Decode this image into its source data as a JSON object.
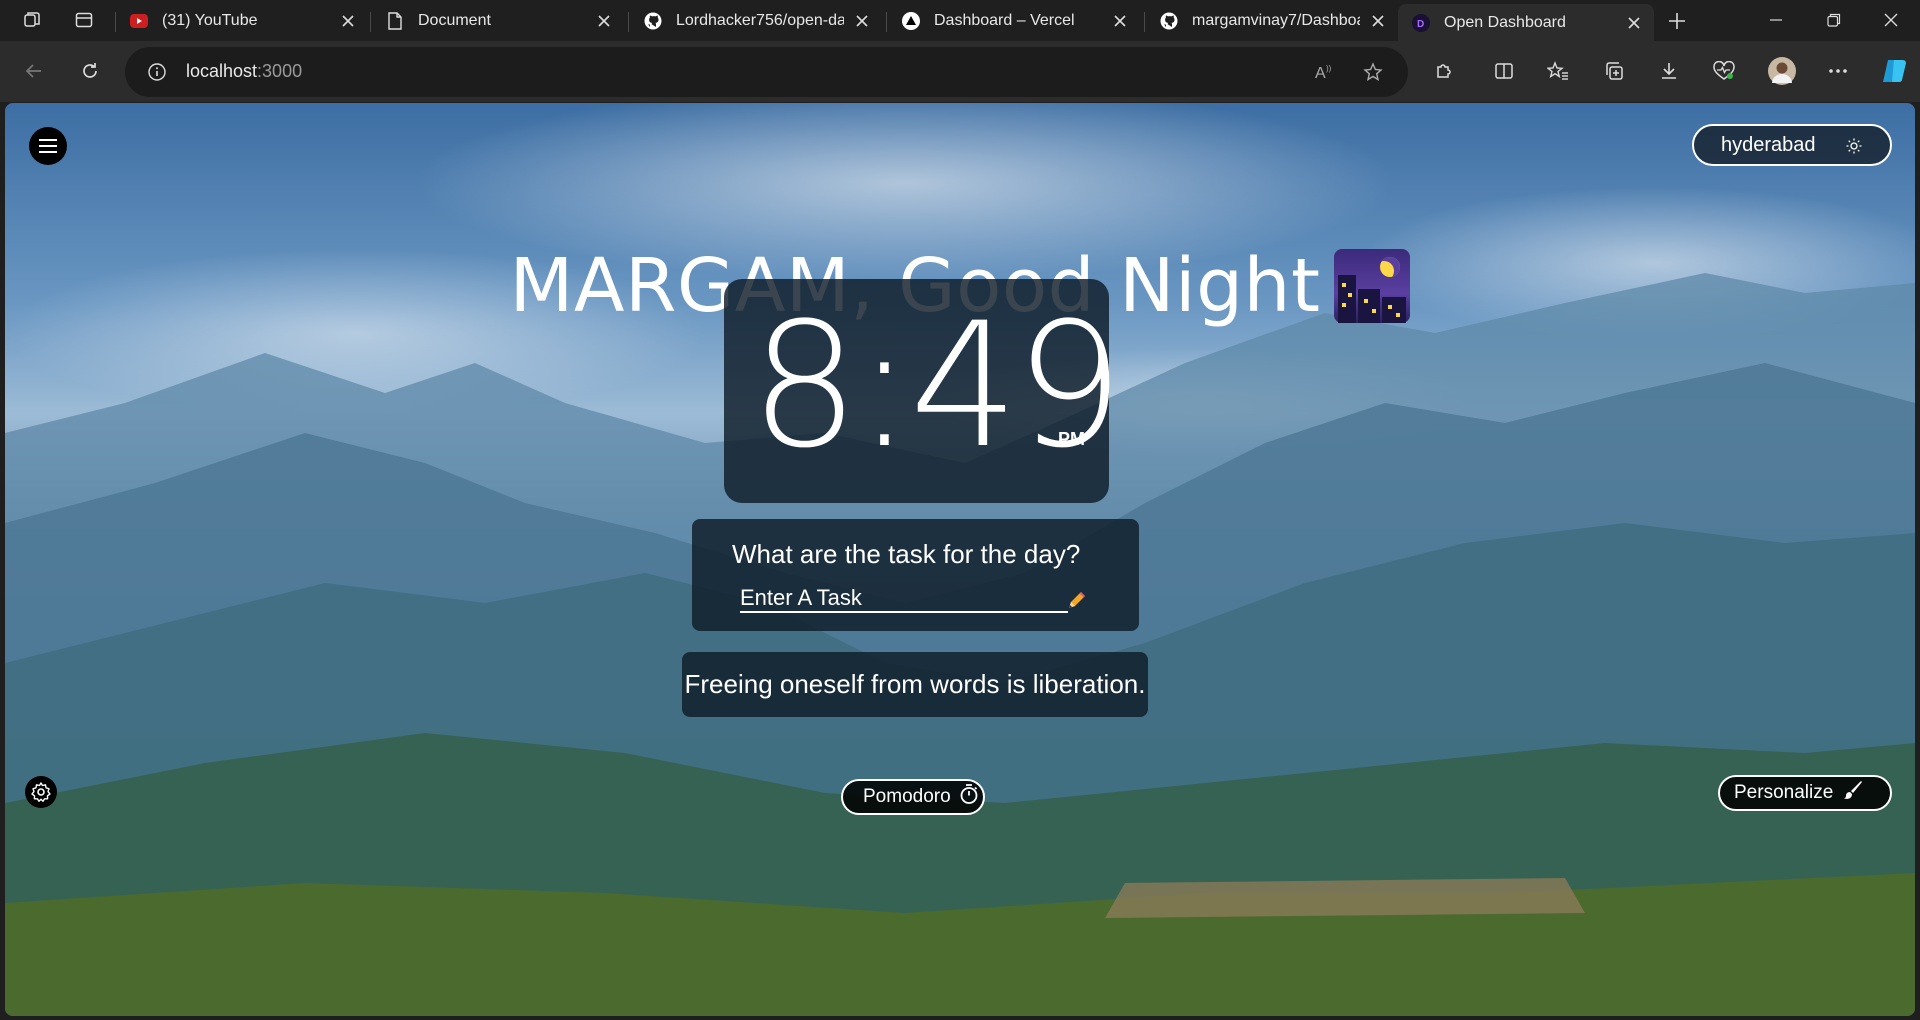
{
  "browser": {
    "tabs": [
      {
        "title": "(31) YouTube",
        "favicon": "youtube-icon"
      },
      {
        "title": "Document",
        "favicon": "document-icon"
      },
      {
        "title": "Lordhacker756/open-dash",
        "favicon": "github-icon"
      },
      {
        "title": "Dashboard – Vercel",
        "favicon": "vercel-icon"
      },
      {
        "title": "margamvinay7/Dashboard",
        "favicon": "github-icon"
      },
      {
        "title": "Open Dashboard",
        "favicon": "open-dashboard-icon",
        "active": true
      }
    ],
    "address": {
      "host": "localhost",
      "port": ":3000"
    }
  },
  "page": {
    "city": "hyderabad",
    "greeting": "MARGAM, Good Night",
    "clock": {
      "time": "8:49",
      "ampm": "PM"
    },
    "task": {
      "question": "What are the task for the day?",
      "placeholder": "Enter A Task"
    },
    "quote": "Freeing oneself from words is liberation.",
    "pomodoro_label": "Pomodoro",
    "personalize_label": "Personalize"
  },
  "colors": {
    "card_bg": "#0f1c28",
    "tab_bar": "#1f1f1f",
    "toolbar": "#2c2c2c"
  }
}
